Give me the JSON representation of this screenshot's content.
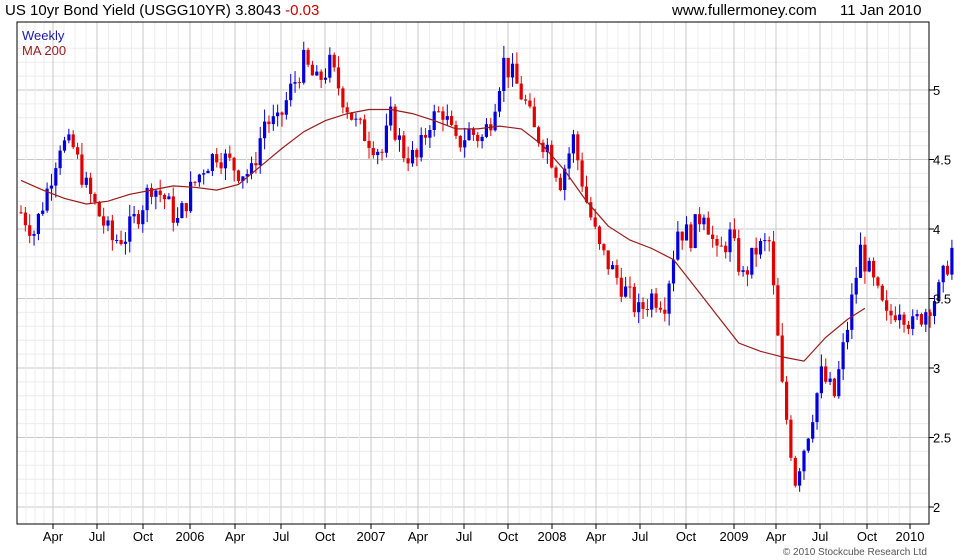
{
  "header": {
    "title": "US 10yr Bond Yield (USGG10YR)",
    "last": "3.8043",
    "change": "-0.03",
    "site": "www.fullermoney.com",
    "date": "11 Jan 2010"
  },
  "legend": {
    "period": "Weekly",
    "ma": "MA 200"
  },
  "copyright": "© 2010 Stockcube Research Ltd",
  "colors": {
    "up": "#0000dd",
    "down": "#e00000",
    "ma": "#9a1b1b",
    "grid": "#dcdcdc",
    "axis": "#000000"
  },
  "chart_data": {
    "type": "candlestick",
    "frequency": "weekly",
    "x_ticks": [
      "Apr",
      "Jul",
      "Oct",
      "2006",
      "Apr",
      "Jul",
      "Oct",
      "2007",
      "Apr",
      "Jul",
      "Oct",
      "2008",
      "Apr",
      "Jul",
      "Oct",
      "2009",
      "Apr",
      "Jul",
      "Oct",
      "2010"
    ],
    "y_ticks": [
      2,
      2.5,
      3,
      3.5,
      4,
      4.5,
      5
    ],
    "ylim": [
      1.95,
      5.35
    ],
    "series": [
      {
        "name": "MA 200",
        "kind": "line",
        "points": [
          [
            0,
            4.35
          ],
          [
            5,
            4.28
          ],
          [
            10,
            4.22
          ],
          [
            15,
            4.18
          ],
          [
            20,
            4.2
          ],
          [
            25,
            4.25
          ],
          [
            30,
            4.28
          ],
          [
            35,
            4.31
          ],
          [
            40,
            4.3
          ],
          [
            45,
            4.28
          ],
          [
            50,
            4.32
          ],
          [
            55,
            4.45
          ],
          [
            60,
            4.58
          ],
          [
            65,
            4.7
          ],
          [
            70,
            4.78
          ],
          [
            75,
            4.83
          ],
          [
            80,
            4.86
          ],
          [
            85,
            4.86
          ],
          [
            90,
            4.83
          ],
          [
            95,
            4.78
          ],
          [
            100,
            4.72
          ],
          [
            105,
            4.72
          ],
          [
            110,
            4.74
          ],
          [
            115,
            4.72
          ],
          [
            120,
            4.6
          ],
          [
            125,
            4.42
          ],
          [
            130,
            4.2
          ],
          [
            135,
            4.02
          ],
          [
            140,
            3.92
          ],
          [
            145,
            3.86
          ],
          [
            150,
            3.78
          ],
          [
            155,
            3.58
          ],
          [
            160,
            3.38
          ],
          [
            165,
            3.18
          ],
          [
            170,
            3.12
          ],
          [
            175,
            3.08
          ],
          [
            180,
            3.05
          ],
          [
            185,
            3.22
          ],
          [
            190,
            3.35
          ],
          [
            194,
            3.43
          ]
        ]
      },
      {
        "name": "Weekly",
        "kind": "candlestick",
        "keypoints": [
          [
            0,
            4.12
          ],
          [
            3,
            3.98
          ],
          [
            6,
            4.28
          ],
          [
            9,
            4.62
          ],
          [
            12,
            4.58
          ],
          [
            15,
            4.3
          ],
          [
            18,
            4.1
          ],
          [
            21,
            3.92
          ],
          [
            24,
            3.95
          ],
          [
            27,
            4.12
          ],
          [
            30,
            4.32
          ],
          [
            33,
            4.22
          ],
          [
            36,
            4.05
          ],
          [
            39,
            4.28
          ],
          [
            42,
            4.45
          ],
          [
            45,
            4.55
          ],
          [
            47,
            4.5
          ],
          [
            50,
            4.42
          ],
          [
            53,
            4.4
          ],
          [
            56,
            4.78
          ],
          [
            59,
            4.75
          ],
          [
            62,
            5.0
          ],
          [
            65,
            5.2
          ],
          [
            68,
            5.05
          ],
          [
            71,
            5.18
          ],
          [
            74,
            4.95
          ],
          [
            77,
            4.75
          ],
          [
            80,
            4.65
          ],
          [
            83,
            4.55
          ],
          [
            85,
            4.8
          ],
          [
            88,
            4.55
          ],
          [
            91,
            4.5
          ],
          [
            94,
            4.78
          ],
          [
            97,
            4.85
          ],
          [
            100,
            4.6
          ],
          [
            103,
            4.7
          ],
          [
            106,
            4.65
          ],
          [
            108,
            4.8
          ],
          [
            111,
            5.2
          ],
          [
            113,
            5.1
          ],
          [
            116,
            4.9
          ],
          [
            118,
            4.7
          ],
          [
            121,
            4.6
          ],
          [
            124,
            4.35
          ],
          [
            127,
            4.65
          ],
          [
            130,
            4.2
          ],
          [
            133,
            3.85
          ],
          [
            136,
            3.7
          ],
          [
            139,
            3.55
          ],
          [
            142,
            3.4
          ],
          [
            145,
            3.52
          ],
          [
            148,
            3.48
          ],
          [
            151,
            4.0
          ],
          [
            154,
            3.95
          ],
          [
            157,
            4.15
          ],
          [
            160,
            3.8
          ],
          [
            163,
            3.95
          ],
          [
            166,
            3.65
          ],
          [
            169,
            3.85
          ],
          [
            172,
            3.9
          ],
          [
            175,
            2.85
          ],
          [
            178,
            2.2
          ],
          [
            181,
            2.55
          ],
          [
            184,
            2.95
          ],
          [
            187,
            2.8
          ],
          [
            190,
            3.3
          ],
          [
            193,
            3.85
          ],
          [
            196,
            3.6
          ],
          [
            199,
            3.35
          ],
          [
            202,
            3.45
          ],
          [
            205,
            3.3
          ],
          [
            208,
            3.42
          ],
          [
            211,
            3.55
          ],
          [
            214,
            3.85
          ]
        ]
      }
    ]
  }
}
